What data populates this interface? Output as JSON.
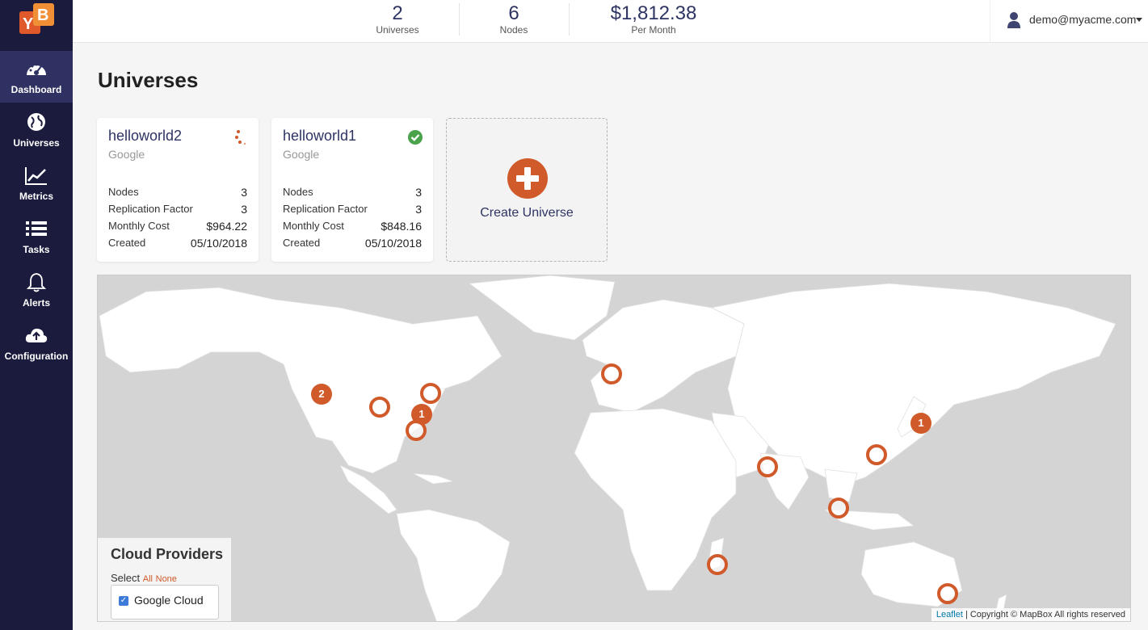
{
  "logo": {
    "text": "YB"
  },
  "sidebar": {
    "items": [
      {
        "label": "Dashboard",
        "icon": "dashboard-icon",
        "active": true
      },
      {
        "label": "Universes",
        "icon": "globe-icon"
      },
      {
        "label": "Metrics",
        "icon": "line-chart-icon"
      },
      {
        "label": "Tasks",
        "icon": "list-icon"
      },
      {
        "label": "Alerts",
        "icon": "bell-icon"
      },
      {
        "label": "Configuration",
        "icon": "cloud-upload-icon"
      }
    ]
  },
  "header": {
    "stats": [
      {
        "value": "2",
        "label": "Universes"
      },
      {
        "value": "6",
        "label": "Nodes"
      },
      {
        "value": "$1,812.38",
        "label": "Per Month"
      }
    ],
    "user": {
      "email": "demo@myacme.com",
      "icon": "user-icon"
    }
  },
  "page_title": "Universes",
  "universes": [
    {
      "name": "helloworld2",
      "provider": "Google",
      "status_icon": "loading-dots-icon",
      "rows": [
        {
          "key": "Nodes",
          "value": "3"
        },
        {
          "key": "Replication Factor",
          "value": "3"
        },
        {
          "key": "Monthly Cost",
          "value": "$964.22"
        },
        {
          "key": "Created",
          "value": "05/10/2018"
        }
      ]
    },
    {
      "name": "helloworld1",
      "provider": "Google",
      "status_icon": "check-circle-icon",
      "rows": [
        {
          "key": "Nodes",
          "value": "3"
        },
        {
          "key": "Replication Factor",
          "value": "3"
        },
        {
          "key": "Monthly Cost",
          "value": "$848.16"
        },
        {
          "key": "Created",
          "value": "05/10/2018"
        }
      ]
    }
  ],
  "create_universe": {
    "label": "Create Universe",
    "icon": "plus-circle-icon"
  },
  "map": {
    "clusters": [
      "2",
      "1",
      "1"
    ],
    "attribution_link": "Leaflet",
    "attribution_text": " | Copyright © MapBox All rights reserved"
  },
  "cloud_providers": {
    "title": "Cloud Providers",
    "select_label": "Select",
    "all": "All",
    "none": "None",
    "providers": [
      {
        "label": "Google Cloud",
        "checked": true
      }
    ]
  },
  "colors": {
    "accent": "#d05a2a",
    "sidebar": "#1a1b3d",
    "navy_text": "#2e3463"
  }
}
